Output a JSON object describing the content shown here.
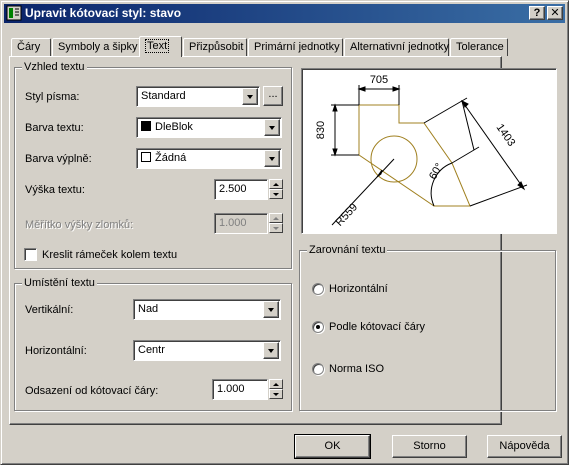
{
  "window": {
    "title": "Upravit kótovací styl: stavo",
    "help_btn": "?",
    "close_btn": "✕"
  },
  "tabs": [
    {
      "label": "Čáry",
      "active": false
    },
    {
      "label": "Symboly a šipky",
      "active": false
    },
    {
      "label": "Text",
      "active": true
    },
    {
      "label": "Přizpůsobit",
      "active": false
    },
    {
      "label": "Primární jednotky",
      "active": false
    },
    {
      "label": "Alternativní jednotky",
      "active": false
    },
    {
      "label": "Tolerance",
      "active": false
    }
  ],
  "text_appearance": {
    "group_label": "Vzhled textu",
    "style_label": "Styl písma:",
    "style_value": "Standard",
    "style_browse": "...",
    "color_label": "Barva textu:",
    "color_value": "DleBlok",
    "color_swatch": "#000000",
    "fill_label": "Barva výplně:",
    "fill_value": "Žádná",
    "height_label": "Výška textu:",
    "height_value": "2.500",
    "fraction_label": "Měřítko výšky zlomků:",
    "fraction_value": "1.000",
    "frame_label": "Kreslit rámeček kolem textu",
    "frame_checked": false
  },
  "text_placement": {
    "group_label": "Umístění textu",
    "vertical_label": "Vertikální:",
    "vertical_value": "Nad",
    "horizontal_label": "Horizontální:",
    "horizontal_value": "Centr",
    "offset_label": "Odsazení od kótovací čáry:",
    "offset_value": "1.000"
  },
  "preview": {
    "dim_top": "705",
    "dim_left": "830",
    "dim_diag": "1403",
    "dim_angle": "60°",
    "dim_radius": "R559",
    "line_color": "#a08020"
  },
  "text_alignment": {
    "group_label": "Zarovnání textu",
    "options": [
      {
        "label": "Horizontální",
        "selected": false
      },
      {
        "label": "Podle kótovací čáry",
        "selected": true
      },
      {
        "label": "Norma ISO",
        "selected": false
      }
    ]
  },
  "buttons": {
    "ok": "OK",
    "cancel": "Storno",
    "help": "Nápověda"
  }
}
